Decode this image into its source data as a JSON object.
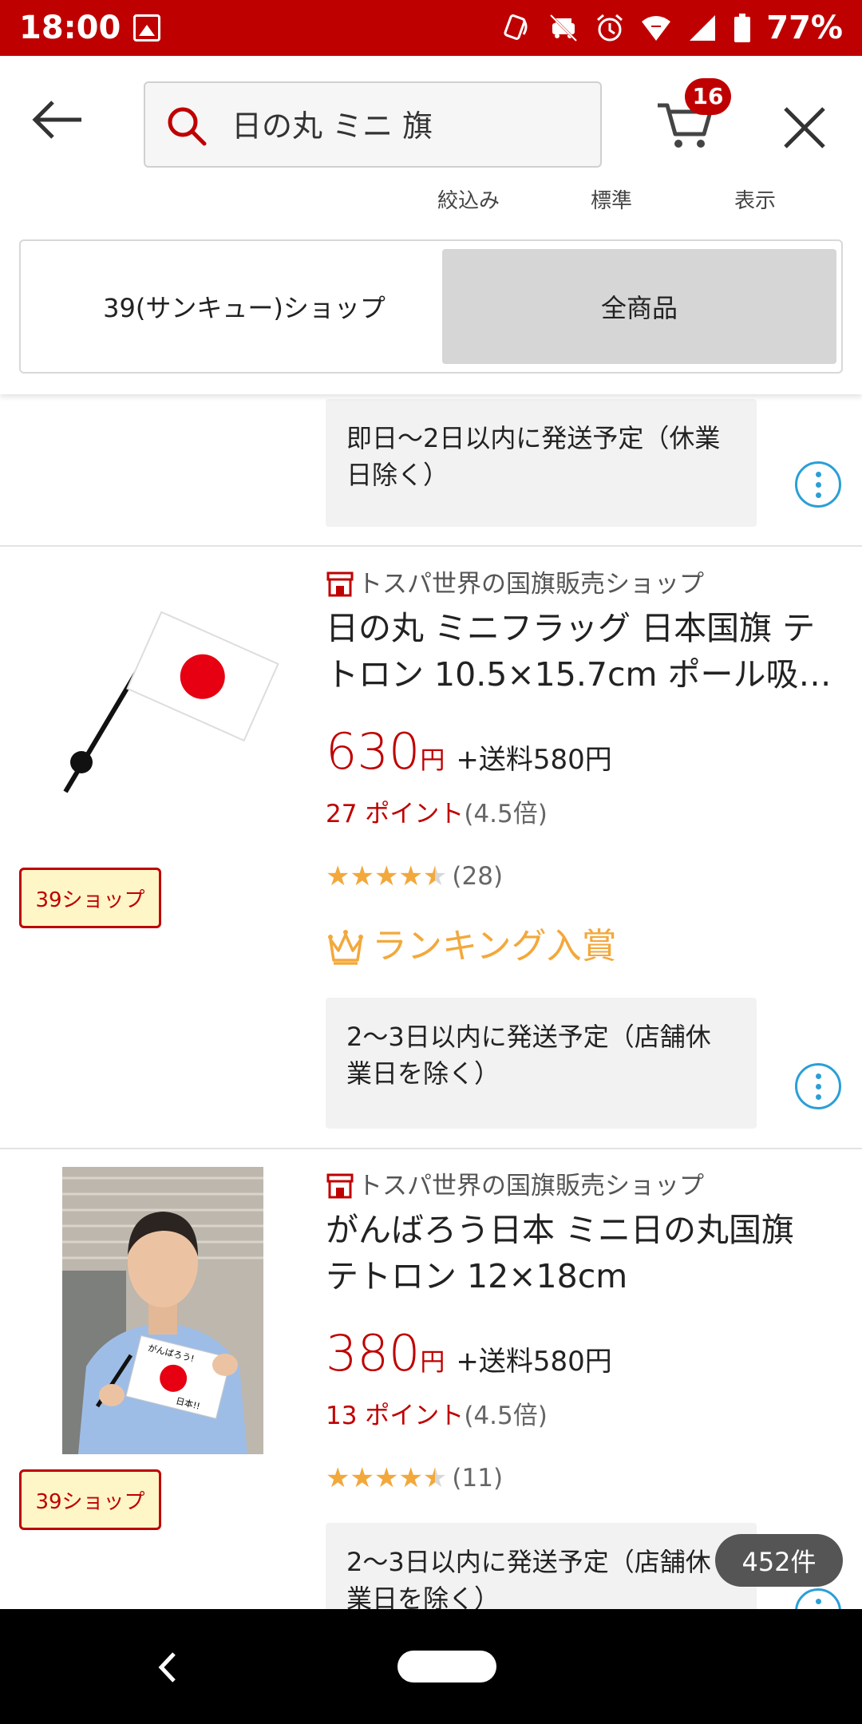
{
  "status_bar": {
    "time": "18:00",
    "battery": "77%"
  },
  "header": {
    "search_query": "日の丸 ミニ 旗",
    "cart_count": "16",
    "sort": {
      "filter": "絞込み",
      "standard": "標準",
      "display": "表示"
    },
    "tabs": {
      "shop": "39(サンキュー)ショップ",
      "all": "全商品"
    }
  },
  "items": [
    {
      "shipping": "即日〜2日以内に発送予定（休業日除く）",
      "shipping_lines": [
        "即日〜2日以内に発送予定（休業",
        "日除く）"
      ]
    },
    {
      "shop": "トスパ世界の国旗販売ショップ",
      "title_lines": [
        "日の丸 ミニフラッグ 日本国旗 テ",
        "トロン 10.5×15.7cm ポール吸…"
      ],
      "price": "630",
      "yen": "円",
      "shipping_fee": "+送料580円",
      "points": "27 ポイント",
      "points_mult": "(4.5倍)",
      "rating": 4.5,
      "review_count": "(28)",
      "ranking": "ランキング入賞",
      "badge": "39ショップ",
      "shipping_lines": [
        "2〜3日以内に発送予定（店舗休",
        "業日を除く）"
      ]
    },
    {
      "shop": "トスパ世界の国旗販売ショップ",
      "title_lines": [
        "がんばろう日本 ミニ日の丸国旗",
        "テトロン 12×18cm"
      ],
      "price": "380",
      "yen": "円",
      "shipping_fee": "+送料580円",
      "points": "13 ポイント",
      "points_mult": "(4.5倍)",
      "rating": 4.5,
      "review_count": "(11)",
      "badge": "39ショップ",
      "flag_text_top": "がんばろう!",
      "flag_text_bottom": "日本!!",
      "shipping_lines": [
        "2〜3日以内に発送予定（店舗休",
        "業日を除く）"
      ]
    }
  ],
  "result_count": "452件",
  "colors": {
    "brand_red": "#bf0000",
    "star": "#f3a83b",
    "info_blue": "#2a9fd6"
  }
}
